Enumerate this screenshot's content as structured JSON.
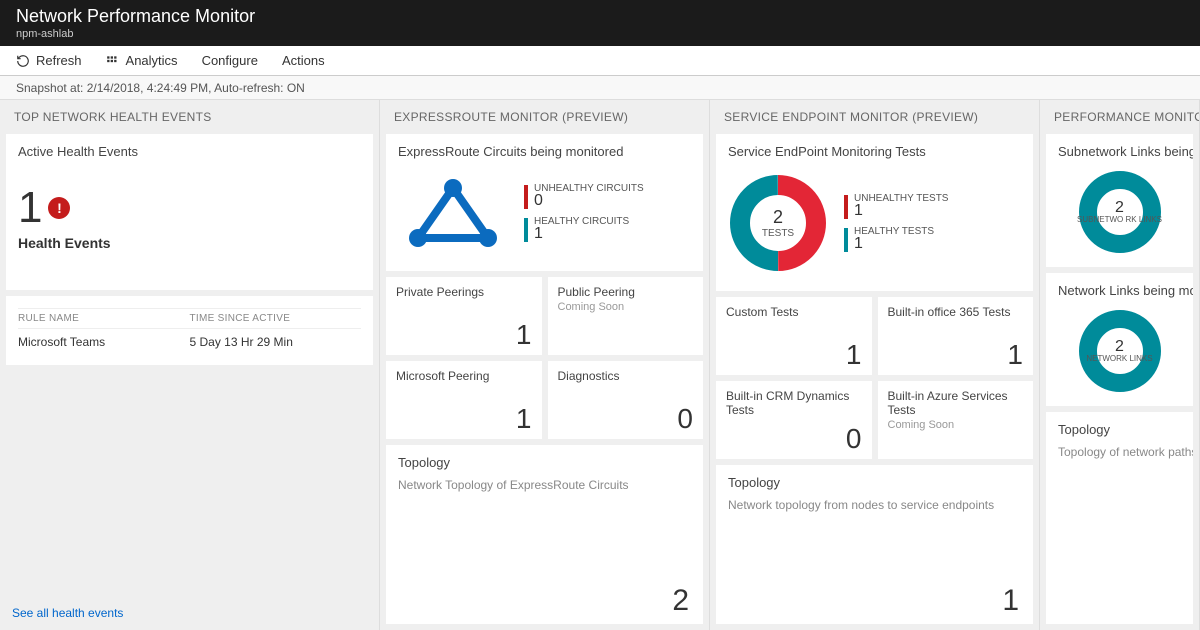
{
  "header": {
    "title": "Network Performance Monitor",
    "subtitle": "npm-ashlab"
  },
  "toolbar": {
    "refresh": "Refresh",
    "analytics": "Analytics",
    "configure": "Configure",
    "actions": "Actions"
  },
  "snapshot": "Snapshot at: 2/14/2018, 4:24:49 PM, Auto-refresh: ON",
  "col1": {
    "header": "TOP NETWORK HEALTH EVENTS",
    "card_title": "Active Health Events",
    "count": "1",
    "count_label": "Health Events",
    "table": {
      "h1": "RULE NAME",
      "h2": "TIME SINCE ACTIVE",
      "rows": [
        {
          "name": "Microsoft Teams",
          "time": "5 Day 13 Hr 29 Min"
        }
      ]
    },
    "see_all": "See all health events"
  },
  "col2": {
    "header": "EXPRESSROUTE MONITOR (PREVIEW)",
    "card_title": "ExpressRoute Circuits being monitored",
    "legend": {
      "unhealthy_label": "UNHEALTHY CIRCUITS",
      "unhealthy_value": "0",
      "healthy_label": "HEALTHY CIRCUITS",
      "healthy_value": "1"
    },
    "tiles": [
      {
        "title": "Private Peerings",
        "value": "1"
      },
      {
        "title": "Public Peering",
        "sub": "Coming Soon"
      },
      {
        "title": "Microsoft Peering",
        "value": "1"
      },
      {
        "title": "Diagnostics",
        "value": "0"
      }
    ],
    "topo": {
      "title": "Topology",
      "sub": "Network Topology of ExpressRoute Circuits",
      "value": "2"
    }
  },
  "col3": {
    "header": "SERVICE ENDPOINT MONITOR (PREVIEW)",
    "card_title": "Service EndPoint Monitoring Tests",
    "donut": {
      "center_value": "2",
      "center_label": "TESTS"
    },
    "legend": {
      "unhealthy_label": "UNHEALTHY TESTS",
      "unhealthy_value": "1",
      "healthy_label": "HEALTHY TESTS",
      "healthy_value": "1"
    },
    "tiles": [
      {
        "title": "Custom Tests",
        "value": "1"
      },
      {
        "title": "Built-in office 365 Tests",
        "value": "1"
      },
      {
        "title": "Built-in CRM Dynamics Tests",
        "value": "0"
      },
      {
        "title": "Built-in Azure Services Tests",
        "sub": "Coming Soon"
      }
    ],
    "topo": {
      "title": "Topology",
      "sub": "Network topology from nodes to service endpoints",
      "value": "1"
    }
  },
  "col4": {
    "header": "PERFORMANCE MONITOR",
    "card1_title": "Subnetwork Links being monitored",
    "ring1": {
      "value": "2",
      "label": "SUBNETWO RK LINKS"
    },
    "card2_title": "Network Links being monitored",
    "ring2": {
      "value": "2",
      "label": "NETWORK LINKS"
    },
    "topo": {
      "title": "Topology",
      "sub": "Topology of network paths"
    }
  },
  "colors": {
    "red": "#c41c1c",
    "teal": "#008b9a",
    "blue": "#0b6bbf"
  }
}
